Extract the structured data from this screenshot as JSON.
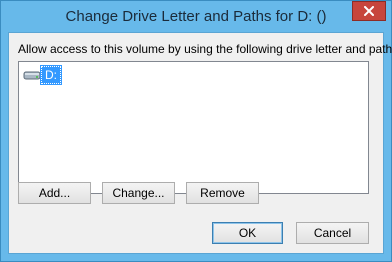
{
  "window": {
    "title": "Change Drive Letter and Paths for D: ()"
  },
  "dialog": {
    "description": "Allow access to this volume by using the following drive letter and paths:",
    "list_items": [
      {
        "label": "D:",
        "icon": "drive-icon",
        "selected": true
      }
    ],
    "buttons": {
      "add": "Add...",
      "change": "Change...",
      "remove": "Remove",
      "ok": "OK",
      "cancel": "Cancel"
    }
  },
  "colors": {
    "frame": "#67b9ea",
    "close": "#c7453c",
    "selection": "#3399ff"
  }
}
